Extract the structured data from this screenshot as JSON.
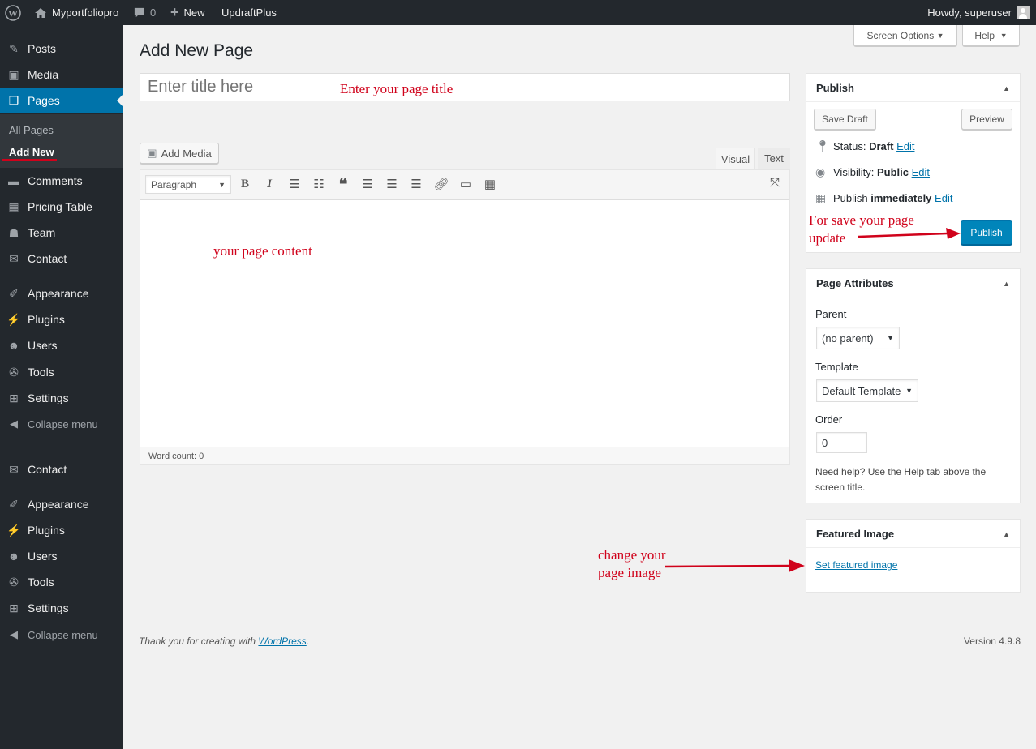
{
  "adminbar": {
    "site_name": "Myportfoliopro",
    "comments_count": "0",
    "new_label": "New",
    "plugin_label": "UpdraftPlus",
    "howdy": "Howdy, superuser"
  },
  "sidebar": {
    "items": [
      {
        "label": "Posts",
        "icon": "pin-icon"
      },
      {
        "label": "Media",
        "icon": "media-icon"
      },
      {
        "label": "Pages",
        "icon": "pages-icon"
      },
      {
        "label": "Comments",
        "icon": "comment-icon"
      },
      {
        "label": "Pricing Table",
        "icon": "table-icon"
      },
      {
        "label": "Team",
        "icon": "team-icon"
      },
      {
        "label": "Contact",
        "icon": "mail-icon"
      },
      {
        "label": "Appearance",
        "icon": "brush-icon"
      },
      {
        "label": "Plugins",
        "icon": "plug-icon"
      },
      {
        "label": "Users",
        "icon": "user-icon"
      },
      {
        "label": "Tools",
        "icon": "wrench-icon"
      },
      {
        "label": "Settings",
        "icon": "settings-icon"
      },
      {
        "label": "Collapse menu",
        "icon": "collapse-icon"
      },
      {
        "label": "Contact",
        "icon": "mail-icon"
      },
      {
        "label": "Appearance",
        "icon": "brush-icon"
      },
      {
        "label": "Plugins",
        "icon": "plug-icon"
      },
      {
        "label": "Users",
        "icon": "user-icon"
      },
      {
        "label": "Tools",
        "icon": "wrench-icon"
      },
      {
        "label": "Settings",
        "icon": "settings-icon"
      },
      {
        "label": "Collapse menu",
        "icon": "collapse-icon"
      }
    ],
    "submenu": [
      "All Pages",
      "Add New"
    ]
  },
  "screen_options": "Screen Options",
  "help": "Help",
  "page_title": "Add New Page",
  "title_placeholder": "Enter title here",
  "add_media": "Add Media",
  "tabs": {
    "visual": "Visual",
    "text": "Text"
  },
  "format_select": "Paragraph",
  "word_count": "Word count: 0",
  "publish": {
    "title": "Publish",
    "save_draft": "Save Draft",
    "preview": "Preview",
    "status_label": "Status:",
    "status_value": "Draft",
    "visibility_label": "Visibility:",
    "visibility_value": "Public",
    "publish_label": "Publish",
    "publish_value": "immediately",
    "edit": "Edit",
    "publish_button": "Publish"
  },
  "page_attributes": {
    "title": "Page Attributes",
    "parent_label": "Parent",
    "parent_value": "(no parent)",
    "template_label": "Template",
    "template_value": "Default Template",
    "order_label": "Order",
    "order_value": "0",
    "help_text": "Need help? Use the Help tab above the screen title."
  },
  "featured_image": {
    "title": "Featured Image",
    "link": "Set featured image"
  },
  "footer": {
    "thanks": "Thank you for creating with",
    "wp_link": "WordPress",
    "version": "Version 4.9.8"
  },
  "annotations": {
    "title": "Enter your page title",
    "content": "your page content",
    "publish_line1": "For save your page",
    "publish_line2": "update",
    "image_line1": "change your",
    "image_line2": "page image"
  },
  "colors": {
    "admin_dark": "#23282d",
    "accent_blue": "#0073aa",
    "annotation_red": "#d0021b"
  }
}
